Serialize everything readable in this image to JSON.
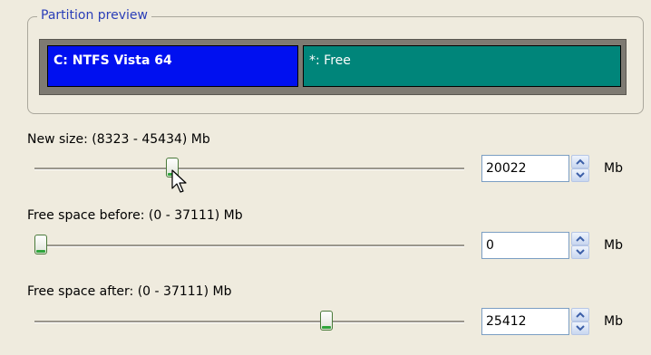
{
  "partition_preview": {
    "title": "Partition preview",
    "partitions": [
      {
        "label": "C: NTFS Vista 64",
        "color": "#0010f0"
      },
      {
        "label": "*: Free",
        "color": "#00857a"
      }
    ]
  },
  "fields": [
    {
      "label": "New size: (8323 - 45434) Mb",
      "value": "20022",
      "unit": "Mb",
      "slider_fraction": 0.315
    },
    {
      "label": "Free space before: (0 - 37111) Mb",
      "value": "0",
      "unit": "Mb",
      "slider_fraction": 0.0
    },
    {
      "label": "Free space after: (0 - 37111) Mb",
      "value": "25412",
      "unit": "Mb",
      "slider_fraction": 0.685
    }
  ]
}
